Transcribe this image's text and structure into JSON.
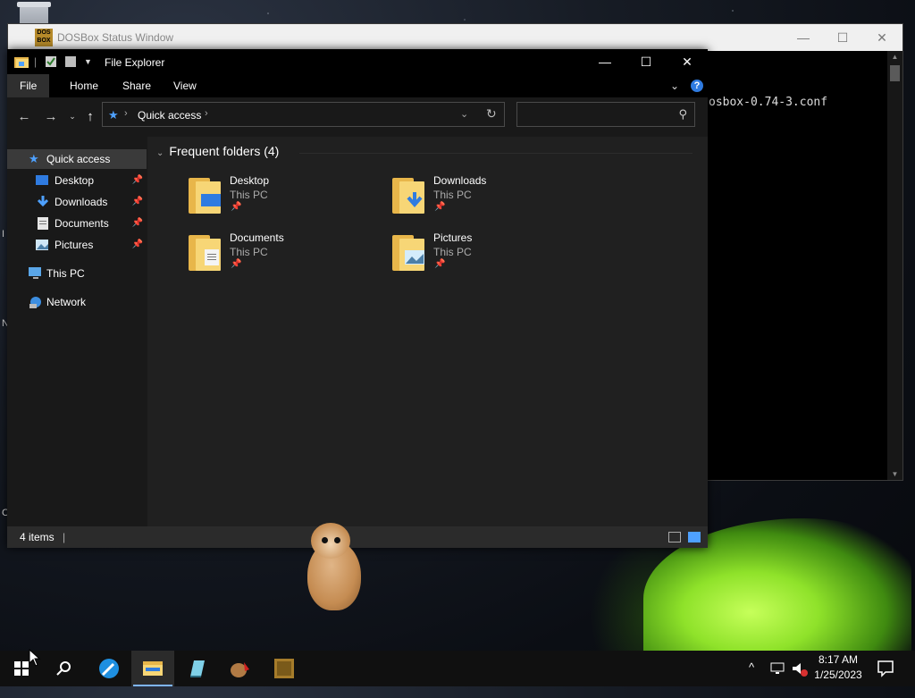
{
  "dosbox": {
    "title": "DOSBox Status Window",
    "icon_text": "DOS BOX",
    "console_text": "osbox-0.74-3.conf",
    "min": "—",
    "max": "☐",
    "close": "✕"
  },
  "explorer": {
    "title": "File Explorer",
    "controls": {
      "min": "—",
      "max": "☐",
      "close": "✕"
    },
    "ribbon": {
      "file": "File",
      "home": "Home",
      "share": "Share",
      "view": "View",
      "help": "?"
    },
    "address": {
      "crumb": "Quick access"
    },
    "search": {
      "placeholder": ""
    },
    "sidebar": [
      {
        "label": "Quick access",
        "icon": "star-icon",
        "pinned": false,
        "selected": true
      },
      {
        "label": "Desktop",
        "icon": "desktop-icon",
        "pinned": true
      },
      {
        "label": "Downloads",
        "icon": "download-icon",
        "pinned": true
      },
      {
        "label": "Documents",
        "icon": "document-icon",
        "pinned": true
      },
      {
        "label": "Pictures",
        "icon": "picture-icon",
        "pinned": true
      },
      {
        "label": "This PC",
        "icon": "computer-icon",
        "pinned": false
      },
      {
        "label": "Network",
        "icon": "network-icon",
        "pinned": false
      }
    ],
    "group_header": "Frequent folders (4)",
    "folders": [
      {
        "name": "Desktop",
        "location": "This PC",
        "icon": "desktop-folder-icon"
      },
      {
        "name": "Downloads",
        "location": "This PC",
        "icon": "downloads-folder-icon"
      },
      {
        "name": "Documents",
        "location": "This PC",
        "icon": "documents-folder-icon"
      },
      {
        "name": "Pictures",
        "location": "This PC",
        "icon": "pictures-folder-icon"
      }
    ],
    "status": {
      "count": "4 items",
      "sep": "|"
    }
  },
  "taskbar": {
    "apps": [
      "start-icon",
      "search-icon",
      "browser-icon",
      "file-explorer-icon",
      "notepad-icon",
      "hamster-app-icon",
      "dosbox-icon"
    ],
    "clock": {
      "time": "8:17 AM",
      "date": "1/25/2023"
    },
    "tray_chevron": "^"
  },
  "colors": {
    "accent": "#4ea1ff",
    "folder": "#f7d676",
    "window_bg": "#191919"
  }
}
